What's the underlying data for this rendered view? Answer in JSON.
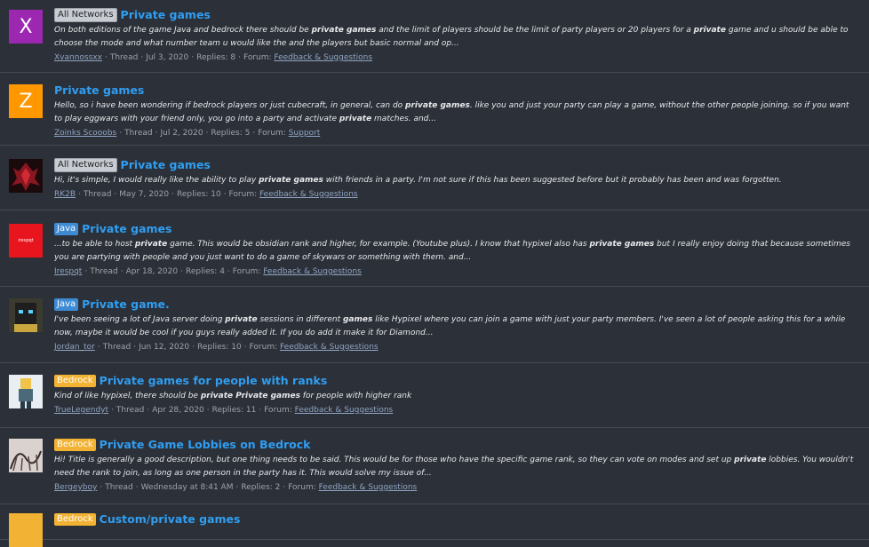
{
  "results": [
    {
      "badge": "All Networks",
      "badge_type": "all",
      "title": "Private games",
      "snippet_parts": [
        "On both editions of the game Java and bedrock there should be ",
        "private games",
        " and the limit of players should be the limit of party players or 20 players for a ",
        "private",
        " game and u should be able to choose the mode and what number team u would like the and the players but basic normal and op..."
      ],
      "author": "Xvannossxx",
      "type": "Thread",
      "date": "Jul 3, 2020",
      "replies": "Replies: 8",
      "forum_prefix": "Forum:",
      "forum": "Feedback & Suggestions",
      "avatar_letter": "X",
      "avatar_color": "#9c27b0"
    },
    {
      "badge": "",
      "badge_type": "",
      "title": "Private games",
      "snippet_parts": [
        "Hello, so i have been wondering if bedrock players or just cubecraft, in general, can do ",
        "private games",
        ". like you and just your party can play a game, without the other people joining. so if you want to play eggwars with your friend only, you go into a party and activate ",
        "private",
        " matches. and..."
      ],
      "author": "Zoinks Scooobs",
      "type": "Thread",
      "date": "Jul 2, 2020",
      "replies": "Replies: 5",
      "forum_prefix": "Forum:",
      "forum": "Support",
      "avatar_letter": "Z",
      "avatar_color": "#ff9800"
    },
    {
      "badge": "All Networks",
      "badge_type": "all",
      "title": "Private games",
      "snippet_parts": [
        "Hi, it's simple, I would really like the ability to play ",
        "private games",
        " with friends in a party. I'm not sure if this has been suggested before but it probably has been and was forgotten."
      ],
      "author": "RK2B",
      "type": "Thread",
      "date": "May 7, 2020",
      "replies": "Replies: 10",
      "forum_prefix": "Forum:",
      "forum": "Feedback & Suggestions",
      "avatar_letter": "",
      "avatar_color": "#2a0d10"
    },
    {
      "badge": "Java",
      "badge_type": "java",
      "title": "Private games",
      "snippet_parts": [
        "...to be able to host ",
        "private",
        " game. This would be obsidian rank and higher, for example. (Youtube plus). I know that hypixel also has ",
        "private games",
        " but I really enjoy doing that because sometimes you are partying with people and you just want to do a game of skywars or something with them. and..."
      ],
      "author": "Irespqt",
      "type": "Thread",
      "date": "Apr 18, 2020",
      "replies": "Replies: 4",
      "forum_prefix": "Forum:",
      "forum": "Feedback & Suggestions",
      "avatar_letter": "",
      "avatar_color": "#e8141e",
      "avatar_text": "irespqt"
    },
    {
      "badge": "Java",
      "badge_type": "java",
      "title": "Private game.",
      "snippet_parts": [
        "I've been seeing a lot of Java server doing ",
        "private",
        " sessions in different ",
        "games",
        " like Hypixel where you can join a game with just your party members. I've seen a lot of people asking this for a while now, maybe it would be cool if you guys really added it. If you do add it make it for Diamond..."
      ],
      "author": "Jordan_tor",
      "type": "Thread",
      "date": "Jun 12, 2020",
      "replies": "Replies: 10",
      "forum_prefix": "Forum:",
      "forum": "Feedback & Suggestions",
      "avatar_letter": "",
      "avatar_color": "#3a3a2e"
    },
    {
      "badge": "Bedrock",
      "badge_type": "bedrock",
      "title": "Private games for people with ranks",
      "snippet_parts": [
        "Kind of like hypixel, there should be ",
        "private Private games",
        " for people with higher rank"
      ],
      "author": "TrueLegendyt",
      "type": "Thread",
      "date": "Apr 28, 2020",
      "replies": "Replies: 11",
      "forum_prefix": "Forum:",
      "forum": "Feedback & Suggestions",
      "avatar_letter": "",
      "avatar_color": "#e9eef2"
    },
    {
      "badge": "Bedrock",
      "badge_type": "bedrock",
      "title": "Private Game Lobbies on Bedrock",
      "snippet_parts": [
        "Hi! Title is generally a good description, but one thing needs to be said. This would be for those who have the specific game rank, so they can vote on modes and set up ",
        "private",
        " lobbies. You wouldn't need the rank to join, as long as one person in the party has it. This would solve my issue of..."
      ],
      "author": "Bergeyboy",
      "type": "Thread",
      "date": "Wednesday at 8:41 AM",
      "replies": "Replies: 2",
      "forum_prefix": "Forum:",
      "forum": "Feedback & Suggestions",
      "avatar_letter": "",
      "avatar_color": "#d9d2cf"
    },
    {
      "badge": "Bedrock",
      "badge_type": "bedrock",
      "title": "Custom/private games",
      "snippet_parts": [],
      "author": "",
      "type": "",
      "date": "",
      "replies": "",
      "forum_prefix": "",
      "forum": "",
      "avatar_letter": "",
      "avatar_color": "#f2b233"
    }
  ]
}
